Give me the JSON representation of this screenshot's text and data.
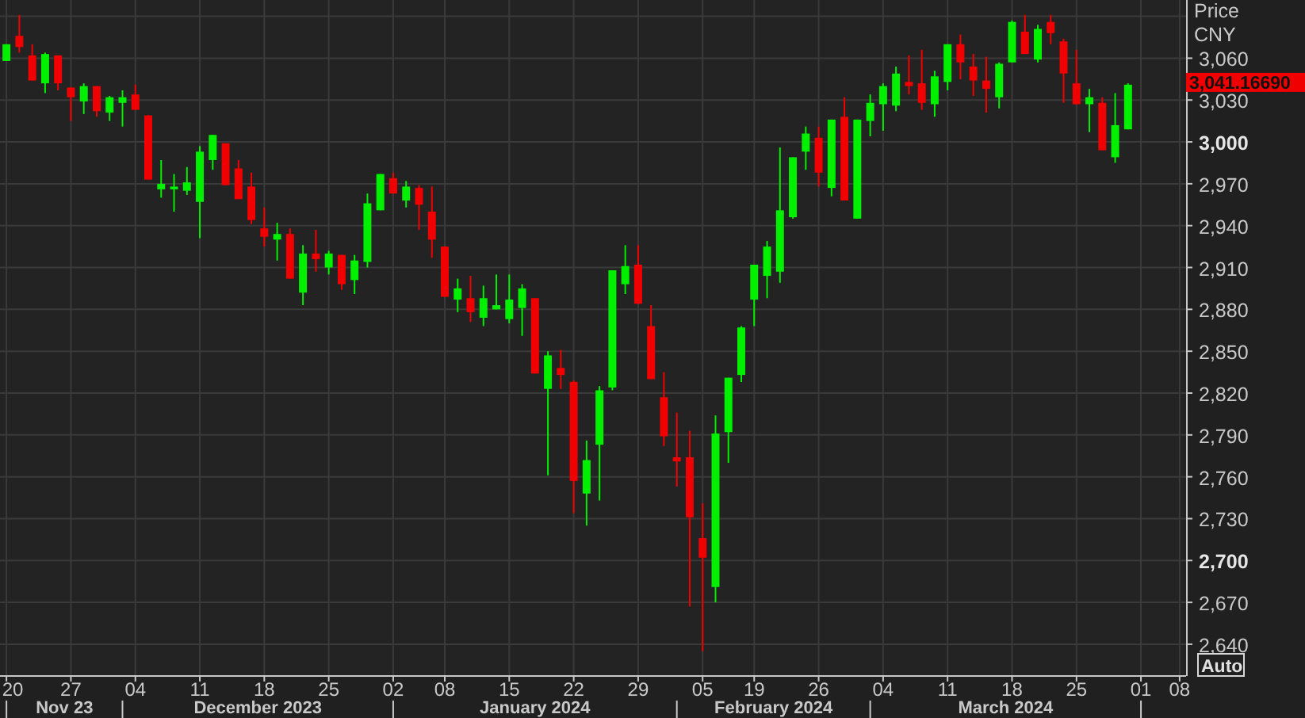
{
  "chart": {
    "axis_title": "Price",
    "currency": "CNY",
    "auto_button": "Auto",
    "month_labels": [
      "Nov 23",
      "December 2023",
      "January 2024",
      "February 2024",
      "March 2024"
    ],
    "chart_data": {
      "type": "candlestick",
      "categories": [
        "20",
        null,
        null,
        null,
        null,
        "27",
        null,
        null,
        null,
        null,
        "04",
        null,
        null,
        null,
        null,
        "11",
        null,
        null,
        null,
        null,
        "18",
        null,
        null,
        null,
        null,
        "25",
        null,
        null,
        null,
        null,
        "02",
        null,
        null,
        null,
        "08",
        null,
        null,
        null,
        null,
        "15",
        null,
        null,
        null,
        null,
        "22",
        null,
        null,
        null,
        null,
        "29",
        null,
        null,
        null,
        null,
        "05",
        null,
        null,
        null,
        "19",
        null,
        null,
        null,
        null,
        "26",
        null,
        null,
        null,
        null,
        "04",
        null,
        null,
        null,
        null,
        "11",
        null,
        null,
        null,
        null,
        "18",
        null,
        null,
        null,
        null,
        "25",
        null,
        null,
        null,
        null,
        "01",
        null,
        null,
        "08"
      ],
      "ohlc": [
        [
          3058,
          3070,
          3058,
          3070
        ],
        [
          3076,
          3091,
          3064,
          3068
        ],
        [
          3062,
          3070,
          3044,
          3044
        ],
        [
          3042,
          3064,
          3035,
          3063
        ],
        [
          3062,
          3062,
          3037,
          3042
        ],
        [
          3039,
          3039,
          3015,
          3032
        ],
        [
          3029,
          3042,
          3020,
          3040
        ],
        [
          3040,
          3040,
          3018,
          3022
        ],
        [
          3021,
          3033,
          3015,
          3032
        ],
        [
          3028,
          3037,
          3011,
          3032
        ],
        [
          3034,
          3041,
          3023,
          3023
        ],
        [
          3019,
          3019,
          2973,
          2973
        ],
        [
          2966,
          2987,
          2960,
          2970
        ],
        [
          2966,
          2977,
          2950,
          2968
        ],
        [
          2965,
          2982,
          2962,
          2971
        ],
        [
          2957,
          2997,
          2931,
          2993
        ],
        [
          2987,
          3005,
          2980,
          3005
        ],
        [
          2999,
          2999,
          2969,
          2969
        ],
        [
          2981,
          2987,
          2959,
          2959
        ],
        [
          2968,
          2978,
          2941,
          2944
        ],
        [
          2938,
          2953,
          2925,
          2932
        ],
        [
          2930,
          2942,
          2915,
          2934
        ],
        [
          2934,
          2938,
          2902,
          2902
        ],
        [
          2892,
          2926,
          2883,
          2920
        ],
        [
          2920,
          2937,
          2907,
          2916
        ],
        [
          2910,
          2922,
          2905,
          2920
        ],
        [
          2919,
          2919,
          2894,
          2898
        ],
        [
          2901,
          2919,
          2891,
          2915
        ],
        [
          2914,
          2963,
          2910,
          2956
        ],
        [
          2951,
          2977,
          2951,
          2977
        ],
        [
          2974,
          2978,
          2963,
          2963
        ],
        [
          2958,
          2972,
          2953,
          2968
        ],
        [
          2967,
          2969,
          2937,
          2955
        ],
        [
          2950,
          2968,
          2917,
          2930
        ],
        [
          2925,
          2925,
          2889,
          2889
        ],
        [
          2887,
          2902,
          2878,
          2895
        ],
        [
          2888,
          2904,
          2871,
          2878
        ],
        [
          2874,
          2897,
          2868,
          2888
        ],
        [
          2880,
          2905,
          2880,
          2883
        ],
        [
          2873,
          2905,
          2870,
          2887
        ],
        [
          2881,
          2898,
          2861,
          2895
        ],
        [
          2888,
          2888,
          2834,
          2834
        ],
        [
          2823,
          2850,
          2761,
          2847
        ],
        [
          2838,
          2851,
          2823,
          2833
        ],
        [
          2828,
          2829,
          2734,
          2757
        ],
        [
          2748,
          2786,
          2725,
          2772
        ],
        [
          2783,
          2825,
          2743,
          2822
        ],
        [
          2824,
          2908,
          2822,
          2908
        ],
        [
          2898,
          2926,
          2891,
          2911
        ],
        [
          2912,
          2926,
          2884,
          2884
        ],
        [
          2868,
          2883,
          2830,
          2830
        ],
        [
          2817,
          2835,
          2782,
          2789
        ],
        [
          2774,
          2806,
          2753,
          2771
        ],
        [
          2774,
          2793,
          2667,
          2731
        ],
        [
          2716,
          2741,
          2635,
          2702
        ],
        [
          2681,
          2804,
          2670,
          2791
        ],
        [
          2792,
          2831,
          2770,
          2831
        ],
        [
          2833,
          2868,
          2828,
          2867
        ],
        [
          2887,
          2912,
          2868,
          2912
        ],
        [
          2904,
          2929,
          2888,
          2925
        ],
        [
          2907,
          2996,
          2899,
          2951
        ],
        [
          2946,
          2989,
          2945,
          2989
        ],
        [
          2993,
          3011,
          2980,
          3006
        ],
        [
          3003,
          3011,
          2968,
          2978
        ],
        [
          2967,
          3016,
          2961,
          3016
        ],
        [
          3018,
          3032,
          2958,
          2958
        ],
        [
          2945,
          3016,
          2945,
          3016
        ],
        [
          3015,
          3034,
          3004,
          3028
        ],
        [
          3027,
          3042,
          3008,
          3040
        ],
        [
          3026,
          3054,
          3022,
          3049
        ],
        [
          3043,
          3062,
          3034,
          3040
        ],
        [
          3042,
          3066,
          3023,
          3028
        ],
        [
          3027,
          3051,
          3018,
          3047
        ],
        [
          3043,
          3070,
          3037,
          3070
        ],
        [
          3070,
          3077,
          3045,
          3057
        ],
        [
          3054,
          3063,
          3033,
          3044
        ],
        [
          3044,
          3061,
          3021,
          3038
        ],
        [
          3032,
          3057,
          3024,
          3056
        ],
        [
          3057,
          3087,
          3057,
          3086
        ],
        [
          3079,
          3091,
          3063,
          3063
        ],
        [
          3059,
          3084,
          3057,
          3081
        ],
        [
          3086,
          3091,
          3070,
          3078
        ],
        [
          3072,
          3074,
          3028,
          3049
        ],
        [
          3042,
          3066,
          3027,
          3027
        ],
        [
          3027,
          3038,
          3007,
          3032
        ],
        [
          3028,
          3032,
          2994,
          2994
        ],
        [
          2989,
          3035,
          2985,
          3012
        ],
        [
          3009,
          3042,
          3009,
          3041
        ],
        null,
        null,
        null,
        null
      ],
      "ylim": [
        2617.8,
        3101.7
      ],
      "yticks": [
        {
          "value": 2640,
          "label": "2,640"
        },
        {
          "value": 2670,
          "label": "2,670"
        },
        {
          "value": 2700,
          "label": "2,700"
        },
        {
          "value": 2730,
          "label": "2,730"
        },
        {
          "value": 2760,
          "label": "2,760"
        },
        {
          "value": 2790,
          "label": "2,790"
        },
        {
          "value": 2820,
          "label": "2,820"
        },
        {
          "value": 2850,
          "label": "2,850"
        },
        {
          "value": 2880,
          "label": "2,880"
        },
        {
          "value": 2910,
          "label": "2,910"
        },
        {
          "value": 2940,
          "label": "2,940"
        },
        {
          "value": 2970,
          "label": "2,970"
        },
        {
          "value": 3000,
          "label": "3,000"
        },
        {
          "value": 3030,
          "label": "3,030"
        },
        {
          "value": 3060,
          "label": "3,060"
        }
      ],
      "grid": true,
      "annotations": [
        "3,041.16690"
      ]
    }
  }
}
